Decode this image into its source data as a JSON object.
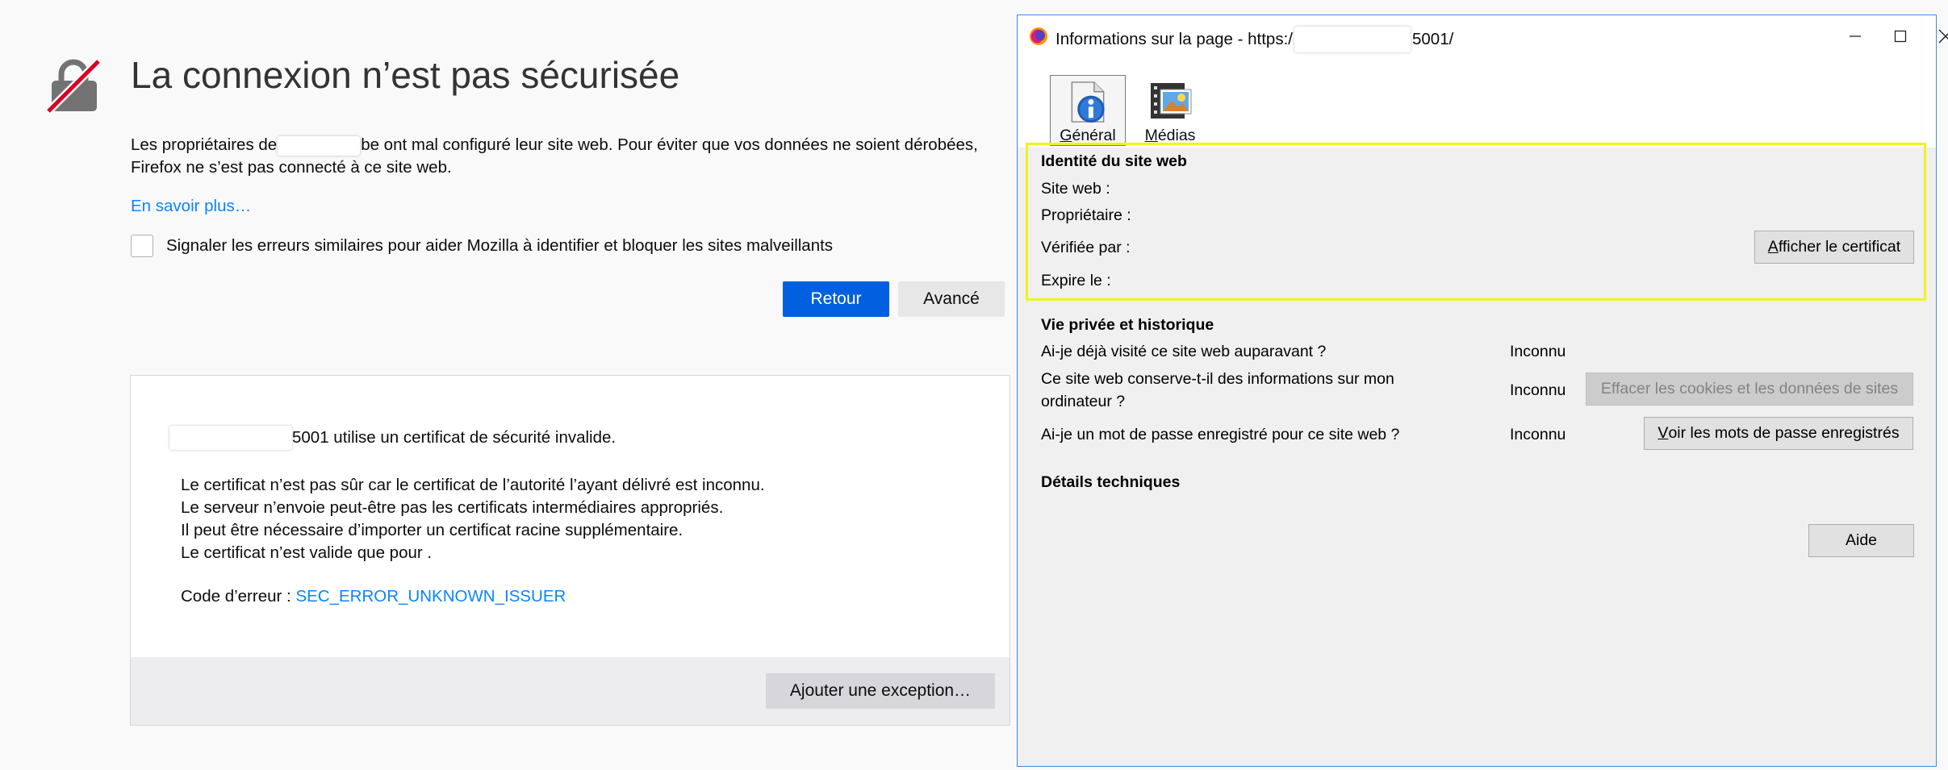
{
  "error_page": {
    "title": "La connexion n’est pas sécurisée",
    "desc_part1": "Les propriétaires de",
    "desc_part2": "be ont mal configuré leur site web. Pour éviter que vos données ne soient dérobées,",
    "desc_line2": "Firefox ne s’est pas connecté à ce site web.",
    "learn_more": "En savoir plus…",
    "report_label": "Signaler les erreurs similaires pour aider Mozilla à identifier et bloquer les sites malveillants",
    "back_button": "Retour",
    "advanced_button": "Avancé",
    "advanced": {
      "host_suffix": "5001 utilise un certificat de sécurité invalide.",
      "lines": [
        "Le certificat n’est pas sûr car le certificat de l’autorité l’ayant délivré est inconnu.",
        "Le serveur n’envoie peut-être pas les certificats intermédiaires appropriés.",
        "Il peut être nécessaire d’importer un certificat racine supplémentaire.",
        "Le certificat n’est valide que pour ."
      ],
      "error_code_label": "Code d’erreur :",
      "error_code": "SEC_ERROR_UNKNOWN_ISSUER",
      "add_exception": "Ajouter une exception…"
    }
  },
  "dialog": {
    "title_prefix": "Informations sur la page - https:/",
    "title_suffix": "5001/",
    "tabs": [
      {
        "accel": "G",
        "rest": "énéral",
        "icon": "info-document-icon"
      },
      {
        "accel": "M",
        "rest": "édias",
        "icon": "media-film-icon"
      }
    ],
    "identity": {
      "heading": "Identité du site web",
      "site_label": "Site web :",
      "owner_label": "Propriétaire :",
      "verified_label": "Vérifiée par :",
      "expires_label": "Expire le :",
      "view_cert_accel": "A",
      "view_cert_rest": "fficher le certificat"
    },
    "privacy": {
      "heading": "Vie privée et historique",
      "visited_q": "Ai-je déjà visité ce site web auparavant ?",
      "visited_a": "Inconnu",
      "stores_q_line1": "Ce site web conserve-t-il des informations sur mon",
      "stores_q_line2": "ordinateur ?",
      "stores_a": "Inconnu",
      "clear_button": "Effacer les cookies et les données de sites",
      "password_q": "Ai-je un mot de passe enregistré pour ce site web ?",
      "password_a": "Inconnu",
      "view_pw_accel": "V",
      "view_pw_rest": "oir les mots de passe enregistrés"
    },
    "technical": {
      "heading": "Détails techniques"
    },
    "help_button": "Aide"
  },
  "colors": {
    "link": "#0a84ff",
    "primary_button": "#0060df",
    "highlight": "#f2f21a",
    "lock_strike": "#d70022"
  }
}
